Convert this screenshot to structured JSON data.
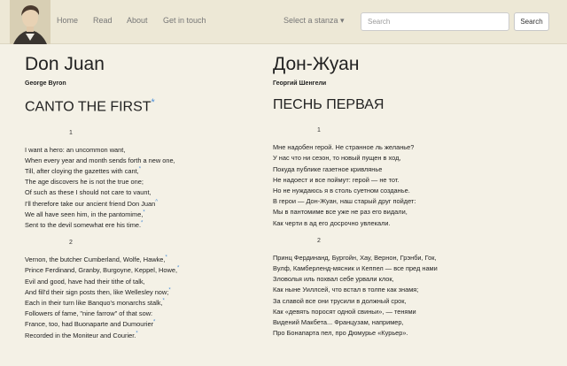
{
  "nav": {
    "home": "Home",
    "read": "Read",
    "about": "About",
    "contact": "Get in touch",
    "stanza_select": "Select a stanza ▾",
    "search_placeholder": "Search",
    "search_button": "Search"
  },
  "left": {
    "title": "Don Juan",
    "author": "George Byron",
    "canto": "CANTO THE FIRST",
    "canto_mark": "*",
    "stanza1_num": "1",
    "stanza2_num": "2",
    "stanza1": [
      "I want a hero: an uncommon want,",
      "When every year and month sends forth a new one,",
      "Till, after cloying the gazettes with cant,",
      "The age discovers he is not the true one;",
      "Of such as these I should not care to vaunt,",
      "I'll therefore take our ancient friend Don Juan",
      "We all have seen him, in the pantomime,",
      "Sent to the devil somewhat ere his time."
    ],
    "stanza2": [
      "Vernon, the butcher Cumberland, Wolfe, Hawke,",
      "Prince Ferdinand, Granby, Burgoyne, Keppel, Howe,",
      "Evil and good, have had their tithe of talk,",
      "And fill'd their sign posts then, like Wellesley now;",
      "Each in their turn like Banquo's monarchs stalk,",
      "Followers of fame, \"nine farrow\" of that sow:",
      "France, too, had Buonaparte and Dumourier",
      "Recorded in the Moniteur and Courier."
    ]
  },
  "right": {
    "title": "Дон-Жуан",
    "author": "Георгий Шенгели",
    "canto": "ПЕСНЬ ПЕРВАЯ",
    "stanza1_num": "1",
    "stanza2_num": "2",
    "stanza1": [
      "Мне надобен герой. Не странное ль желанье?",
      "У нас что ни сезон, то новый пущен в ход,",
      "Покуда публике газетное кривлянье",
      "Не надоест и все поймут: герой — не тот.",
      "Но не нуждаюсь я в столь суетном созданье.",
      "В герои — Дон-Жуан, наш старый друг пойдет:",
      "Мы в пантомиме все уже не раз его видали,",
      "Как черти в ад его досрочно увлекали."
    ],
    "stanza2": [
      "Принц Фердинанд, Бургойн, Хау, Вернон, Грэнби, Гок,",
      "Вулф, Камберленд-мясник и Кеппел — все пред нами",
      "Зловолья иль похвал себе урвали клок,",
      "Как ныне Уиллсей, что встал в толпе как знамя;",
      "За славой все они трусили в должный срок,",
      "Как «девять поросят одной свиньи», — тенями",
      "Видений Макбета... Французам, например,",
      "Про Бонапарта пел, про Дюмурье «Курьер»."
    ]
  },
  "colors": {
    "background": "#f4f1e6",
    "navbar": "#ede8d6",
    "note_marker": "#4a8fd8"
  }
}
